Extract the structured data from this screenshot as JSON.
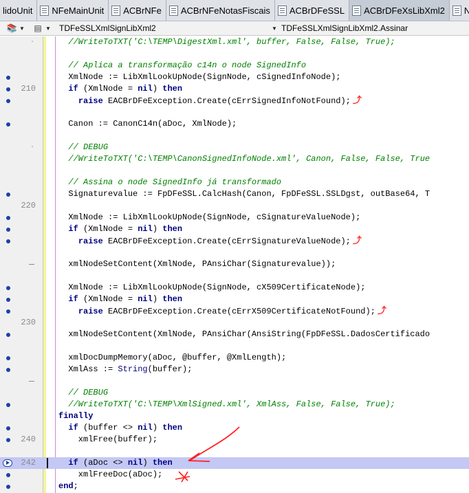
{
  "tabs": [
    {
      "label": "lidoUnit",
      "icon": "none",
      "active": false
    },
    {
      "label": "NFeMainUnit",
      "icon": "unit-file-icon",
      "active": false
    },
    {
      "label": "ACBrNFe",
      "icon": "unit-file-icon",
      "active": false
    },
    {
      "label": "ACBrNFeNotasFiscais",
      "icon": "unit-file-icon",
      "active": false
    },
    {
      "label": "ACBrDFeSSL",
      "icon": "unit-file-icon",
      "active": false
    },
    {
      "label": "ACBrDFeXsLibXml2",
      "icon": "unit-file-icon",
      "active": true
    },
    {
      "label": "NFESt",
      "icon": "unit-file-icon",
      "active": false
    }
  ],
  "navbar": {
    "class_combo": "TDFeSSLXmlSignLibXml2",
    "method_combo": "TDFeSSLXmlSignLibXml2.Assinar"
  },
  "editor": {
    "lines": [
      {
        "num": "",
        "mark": "tick",
        "html": "  <span class=\"cm\">//WriteToTXT('C:\\TEMP\\DigestXml.xml', buffer, False, False, True);</span>"
      },
      {
        "num": "",
        "mark": "none",
        "html": ""
      },
      {
        "num": "",
        "mark": "none",
        "html": "  <span class=\"cm\">// Aplica a transformação c14n o node SignedInfo</span>"
      },
      {
        "num": "",
        "mark": "dot",
        "html": "  XmlNode := LibXmlLookUpNode(SignNode, cSignedInfoNode);"
      },
      {
        "num": "210",
        "mark": "dot",
        "html": "  <span class=\"kw\">if</span> (XmlNode = <span class=\"kw\">nil</span>) <span class=\"kw\">then</span>"
      },
      {
        "num": "",
        "mark": "dot",
        "html": "    <span class=\"kw\">raise</span> EACBrDFeException.Create(cErrSignedInfoNotFound);",
        "hint": true
      },
      {
        "num": "",
        "mark": "none",
        "html": ""
      },
      {
        "num": "",
        "mark": "dot",
        "html": "  Canon := CanonC14n(aDoc, XmlNode);"
      },
      {
        "num": "",
        "mark": "none",
        "html": ""
      },
      {
        "num": "",
        "mark": "tick",
        "html": "  <span class=\"cm\">// DEBUG</span>"
      },
      {
        "num": "",
        "mark": "none",
        "html": "  <span class=\"cm\">//WriteToTXT('C:\\TEMP\\CanonSignedInfoNode.xml', Canon, False, False, True</span>"
      },
      {
        "num": "",
        "mark": "none",
        "html": ""
      },
      {
        "num": "",
        "mark": "none",
        "html": "  <span class=\"cm\">// Assina o node SignedInfo já transformado</span>"
      },
      {
        "num": "",
        "mark": "dot",
        "html": "  Signaturevalue := FpDFeSSL.CalcHash(Canon, FpDFeSSL.SSLDgst, outBase64, T"
      },
      {
        "num": "220",
        "mark": "none",
        "html": ""
      },
      {
        "num": "",
        "mark": "dot",
        "html": "  XmlNode := LibXmlLookUpNode(SignNode, cSignatureValueNode);"
      },
      {
        "num": "",
        "mark": "dot",
        "html": "  <span class=\"kw\">if</span> (XmlNode = <span class=\"kw\">nil</span>) <span class=\"kw\">then</span>"
      },
      {
        "num": "",
        "mark": "dot",
        "html": "    <span class=\"kw\">raise</span> EACBrDFeException.Create(cErrSignatureValueNode);",
        "hint": true
      },
      {
        "num": "",
        "mark": "none",
        "html": ""
      },
      {
        "num": "",
        "mark": "dash",
        "html": "  xmlNodeSetContent(XmlNode, PAnsiChar(Signaturevalue));"
      },
      {
        "num": "",
        "mark": "none",
        "html": ""
      },
      {
        "num": "",
        "mark": "dot",
        "html": "  XmlNode := LibXmlLookUpNode(SignNode, cX509CertificateNode);"
      },
      {
        "num": "",
        "mark": "dot",
        "html": "  <span class=\"kw\">if</span> (XmlNode = <span class=\"kw\">nil</span>) <span class=\"kw\">then</span>"
      },
      {
        "num": "",
        "mark": "dot",
        "html": "    <span class=\"kw\">raise</span> EACBrDFeException.Create(cErrX509CertificateNotFound);",
        "hint": true
      },
      {
        "num": "230",
        "mark": "none",
        "html": ""
      },
      {
        "num": "",
        "mark": "dot",
        "html": "  xmlNodeSetContent(XmlNode, PAnsiChar(AnsiString(FpDFeSSL.DadosCertificado"
      },
      {
        "num": "",
        "mark": "none",
        "html": ""
      },
      {
        "num": "",
        "mark": "dot",
        "html": "  xmlDocDumpMemory(aDoc, @buffer, @XmlLength);"
      },
      {
        "num": "",
        "mark": "dot",
        "html": "  XmlAss := <span class=\"tp\">String</span>(buffer);"
      },
      {
        "num": "",
        "mark": "dash",
        "html": ""
      },
      {
        "num": "",
        "mark": "none",
        "html": "  <span class=\"cm\">// DEBUG</span>"
      },
      {
        "num": "",
        "mark": "dot",
        "html": "  <span class=\"cm\">//WriteToTXT('C:\\TEMP\\XmlSigned.xml', XmlAss, False, False, True);</span>"
      },
      {
        "num": "",
        "mark": "none",
        "html": "<span class=\"kw\">finally</span>"
      },
      {
        "num": "",
        "mark": "dot",
        "html": "  <span class=\"kw\">if</span> (buffer &lt;&gt; <span class=\"kw\">nil</span>) <span class=\"kw\">then</span>"
      },
      {
        "num": "240",
        "mark": "dot",
        "html": "    xmlFree(buffer);"
      },
      {
        "num": "",
        "mark": "none",
        "html": ""
      },
      {
        "num": "242",
        "mark": "exec",
        "html": "  <span class=\"kw\">if</span> (aDoc &lt;&gt; <span class=\"kw\">nil</span>) <span class=\"kw\">then</span>",
        "current": true
      },
      {
        "num": "",
        "mark": "dot",
        "html": "    xmlFreeDoc(aDoc);"
      },
      {
        "num": "",
        "mark": "dot",
        "html": "<span class=\"kw\">end</span>;"
      }
    ]
  },
  "colors": {
    "execution_line": "#c3c8f4",
    "breakpoint_dot": "#1f3fa6",
    "keyword": "#000080",
    "comment": "#008000",
    "annotation_ink": "#ff2020"
  }
}
